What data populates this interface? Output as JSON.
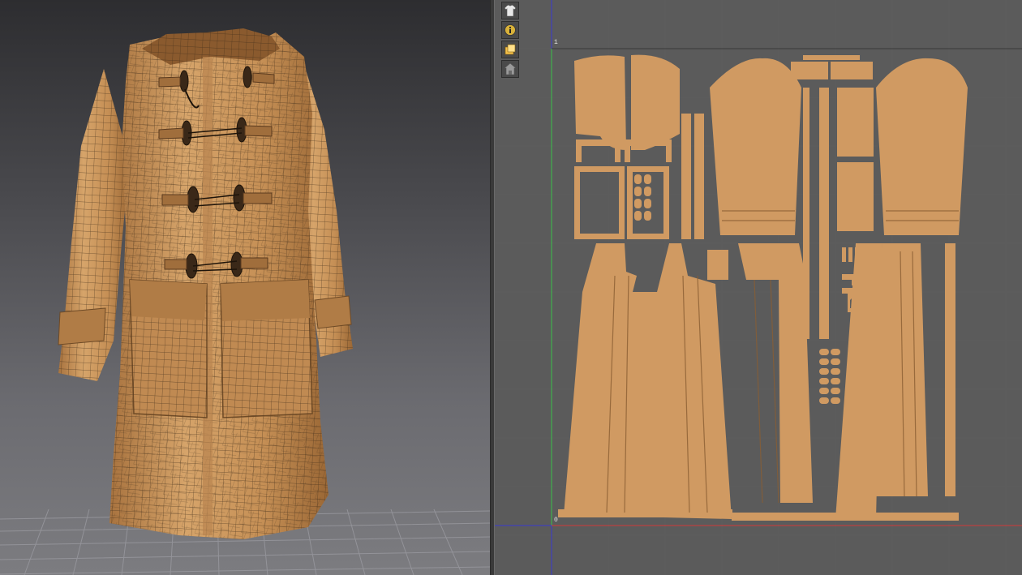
{
  "viewport_3d": {
    "floor_grid": "on",
    "garment_color": "#c9955a",
    "wire_color": "#3b2a18"
  },
  "viewport_2d": {
    "axis": {
      "origin_label": "0",
      "top_label": "1",
      "x_axis_color": "#d23a3a",
      "y_axis_color": "#3ac24a",
      "border_color": "#3a3ad2"
    },
    "pattern_color": "#d09a62",
    "toolbar": [
      {
        "icon": "shirt-icon"
      },
      {
        "icon": "info-icon"
      },
      {
        "icon": "layer-icon"
      },
      {
        "icon": "house-shirt-icon"
      }
    ]
  }
}
